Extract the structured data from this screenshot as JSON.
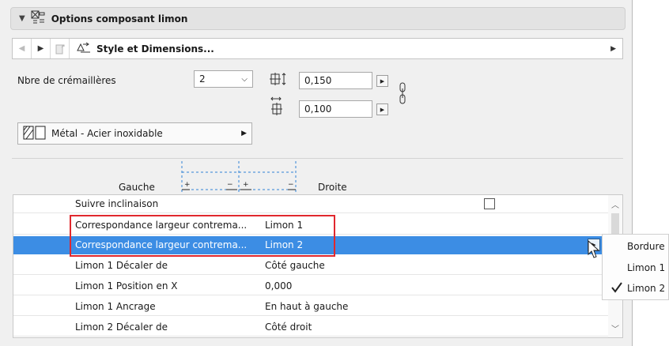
{
  "panel": {
    "title": "Options composant limon",
    "header_icon": "stair-component-icon"
  },
  "nav": {
    "prev_icon": "prev-arrow-icon",
    "next_icon": "next-arrow-icon",
    "page_icon": "page-export-icon",
    "style_icon": "style-dimensions-icon",
    "style_label": "Style et Dimensions...",
    "expand_icon": "expand-arrow-icon"
  },
  "settings": {
    "cremailleres_label": "Nbre de crémaillères",
    "cremailleres_value": "2",
    "width_value": "0,150",
    "height_value": "0,100",
    "material_label": "Métal - Acier inoxidable"
  },
  "diagram": {
    "left_label": "Gauche",
    "right_label": "Droite"
  },
  "table": {
    "rows": [
      {
        "name": "Suivre inclinaison",
        "value": ""
      },
      {
        "name": "Correspondance largeur contrema...",
        "value": "Limon 1"
      },
      {
        "name": "Correspondance largeur contrema...",
        "value": "Limon 2"
      },
      {
        "name": "Limon 1 Décaler de",
        "value": "Côté gauche"
      },
      {
        "name": "Limon 1 Position en X",
        "value": "0,000"
      },
      {
        "name": "Limon 1 Ancrage",
        "value": "En haut à gauche"
      },
      {
        "name": "Limon 2 Décaler de",
        "value": "Côté droit"
      }
    ],
    "selected_index": 2
  },
  "popup": {
    "items": [
      "Bordure",
      "Limon 1",
      "Limon 2"
    ],
    "checked": "Limon 2"
  },
  "colors": {
    "selection": "#3c8de4",
    "highlight_border": "#e0282e"
  }
}
